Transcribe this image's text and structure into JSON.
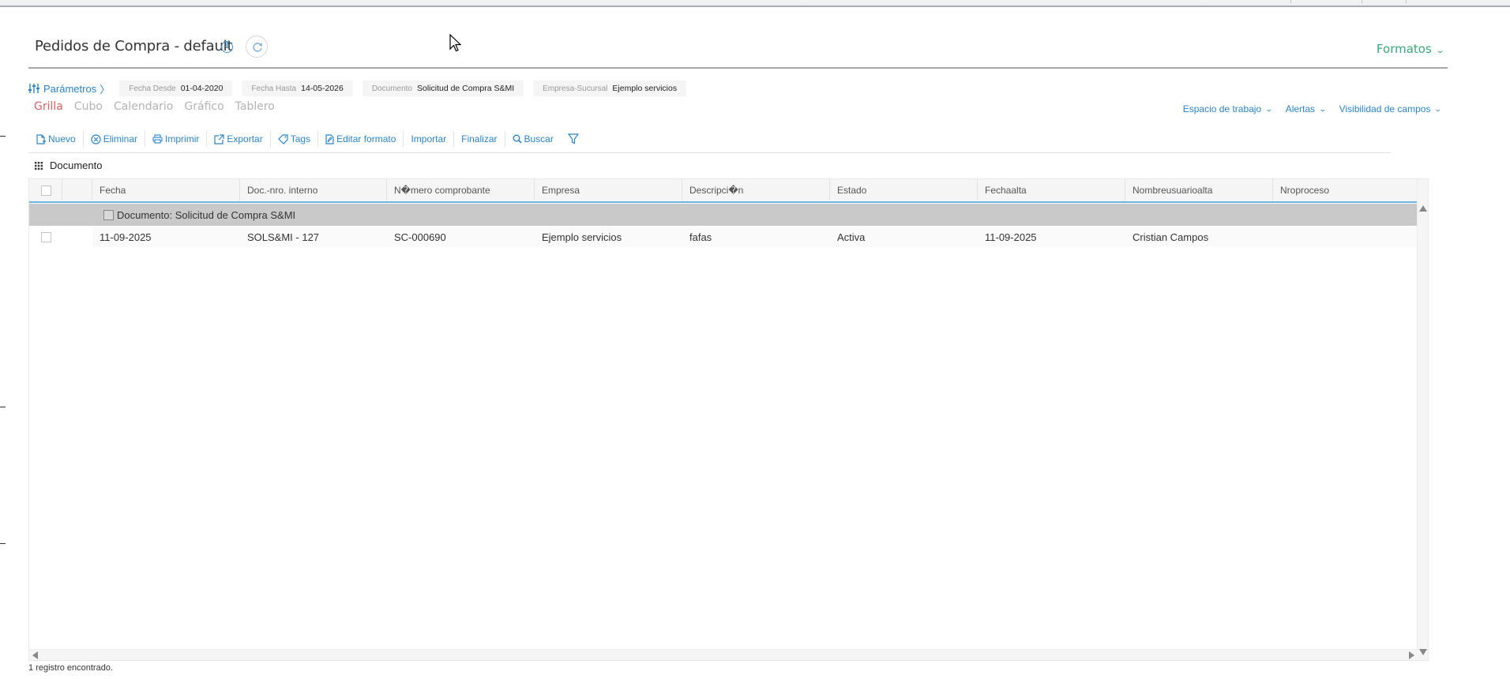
{
  "page": {
    "title": "Pedidos de Compra - default",
    "formatos_label": "Formatos"
  },
  "params": {
    "link_label": "Parámetros",
    "items": [
      {
        "label": "Fecha Desde",
        "value": "01-04-2020"
      },
      {
        "label": "Fecha Hasta",
        "value": "14-05-2026"
      },
      {
        "label": "Documento",
        "value": "Solicitud de Compra S&MI"
      },
      {
        "label": "Empresa-Sucursal",
        "value": "Ejemplo servicios"
      }
    ]
  },
  "view_tabs": [
    {
      "label": "Grilla",
      "active": true
    },
    {
      "label": "Cubo",
      "active": false
    },
    {
      "label": "Calendario",
      "active": false
    },
    {
      "label": "Gráfico",
      "active": false
    },
    {
      "label": "Tablero",
      "active": false
    }
  ],
  "right_menus": [
    "Espacio de trabajo",
    "Alertas",
    "Visibilidad de campos"
  ],
  "toolbar": {
    "nuevo": "Nuevo",
    "eliminar": "Eliminar",
    "imprimir": "Imprimir",
    "exportar": "Exportar",
    "tags": "Tags",
    "editar_formato": "Editar formato",
    "importar": "Importar",
    "finalizar": "Finalizar",
    "buscar": "Buscar"
  },
  "grouping": {
    "label": "Documento"
  },
  "grid": {
    "columns": [
      "Fecha",
      "Doc.-nro. interno",
      "N�mero comprobante",
      "Empresa",
      "Descripci�n",
      "Estado",
      "Fechaalta",
      "Nombreusuarioalta",
      "Nroproceso"
    ],
    "group_label": "Documento: Solicitud de Compra S&MI",
    "rows": [
      [
        "11-09-2025",
        "SOLS&MI - 127",
        "SC-000690",
        "Ejemplo servicios",
        "fafas",
        "Activa",
        "11-09-2025",
        "Cristian Campos",
        ""
      ]
    ]
  },
  "status": "1 registro encontrado.",
  "colors": {
    "accent_blue": "#2b84c8",
    "formatos_green": "#3aa878",
    "active_tab_red": "#e06060",
    "group_row_gray": "#c9c9c9"
  }
}
